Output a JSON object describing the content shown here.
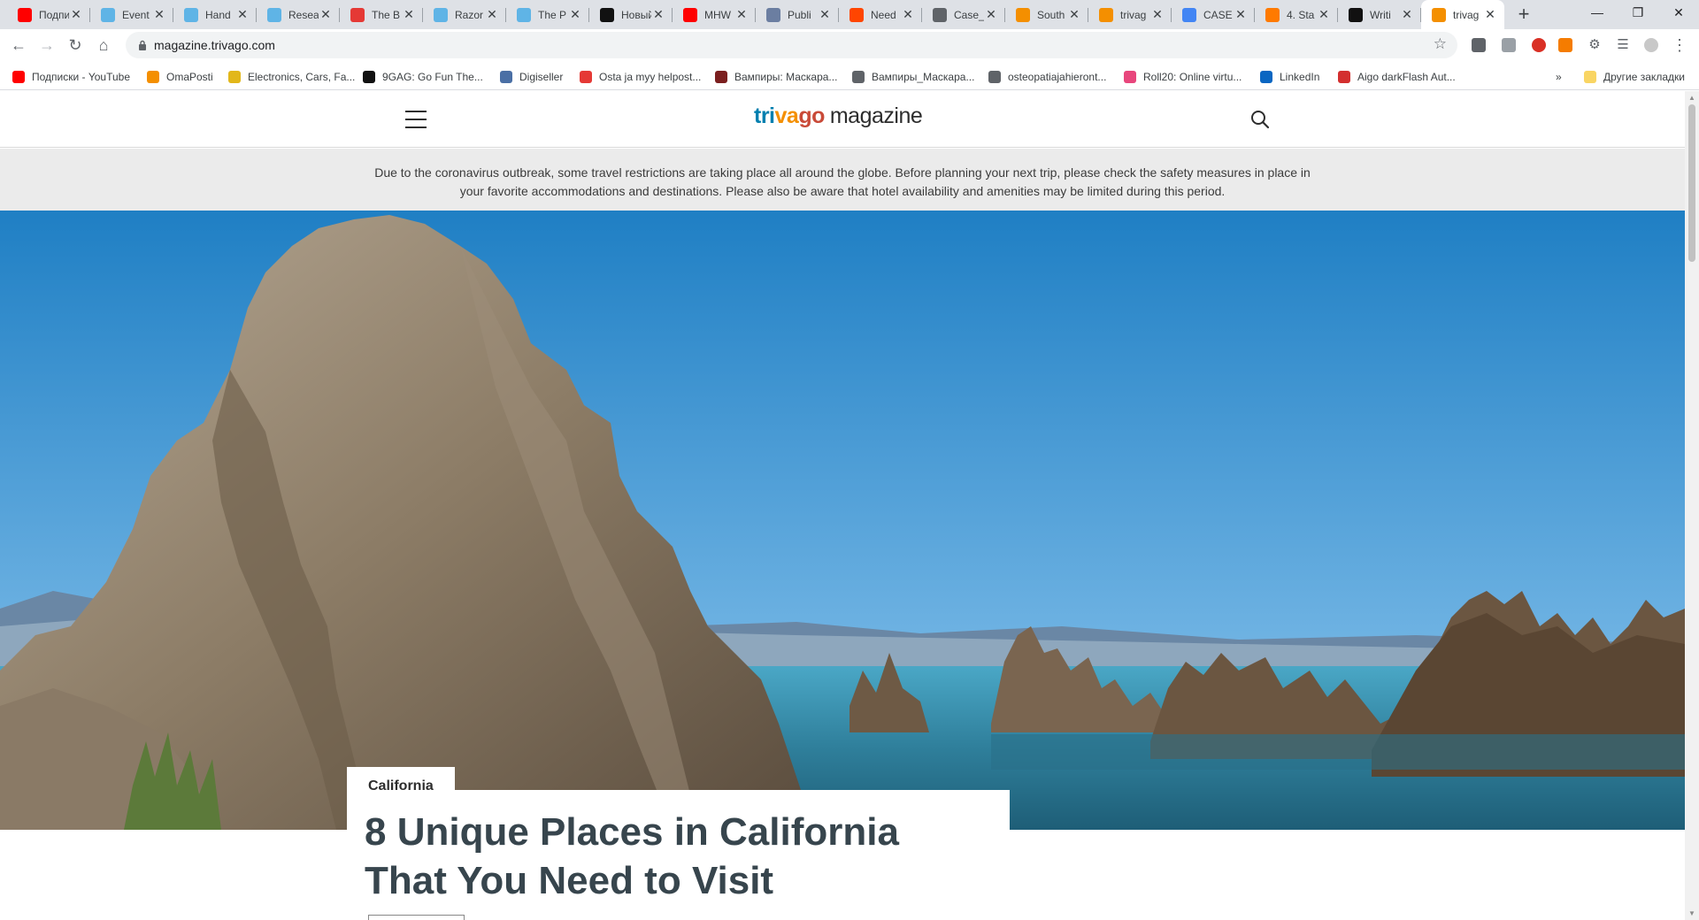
{
  "browser": {
    "tabs": [
      {
        "title": "Подписки",
        "favicon": "youtube-icon",
        "color": "#ff0000"
      },
      {
        "title": "Event",
        "favicon": "product-hunt-icon",
        "color": "#5fb4e6"
      },
      {
        "title": "Hand",
        "favicon": "product-hunt-icon",
        "color": "#5fb4e6"
      },
      {
        "title": "Resea",
        "favicon": "product-hunt-icon",
        "color": "#5fb4e6"
      },
      {
        "title": "The B",
        "favicon": "red-grid-icon",
        "color": "#e53935"
      },
      {
        "title": "Razor",
        "favicon": "product-hunt-icon",
        "color": "#5fb4e6"
      },
      {
        "title": "The P",
        "favicon": "product-hunt-icon",
        "color": "#5fb4e6"
      },
      {
        "title": "Новый",
        "favicon": "k-icon",
        "color": "#111111"
      },
      {
        "title": "MHW",
        "favicon": "youtube-icon",
        "color": "#ff0000"
      },
      {
        "title": "Publi",
        "favicon": "elephant-icon",
        "color": "#6b7ea1"
      },
      {
        "title": "Need",
        "favicon": "reddit-icon",
        "color": "#ff4500"
      },
      {
        "title": "Case_",
        "favicon": "globe-icon",
        "color": "#5f6368"
      },
      {
        "title": "South",
        "favicon": "trivago-icon",
        "color": "#f48f00"
      },
      {
        "title": "trivag",
        "favicon": "trivago-icon",
        "color": "#f48f00"
      },
      {
        "title": "CASE",
        "favicon": "docs-icon",
        "color": "#4285f4"
      },
      {
        "title": "4. Sta",
        "favicon": "butterfly-icon",
        "color": "#ff7a00"
      },
      {
        "title": "Writi",
        "favicon": "medium-icon",
        "color": "#111111"
      },
      {
        "title": "trivag",
        "favicon": "trivago-icon",
        "color": "#f48f00",
        "active": true
      }
    ],
    "new_tab_label": "+",
    "url": "magazine.trivago.com",
    "bookmarks": [
      {
        "label": "Подписки - YouTube",
        "icon": "youtube-icon",
        "color": "#ff0000"
      },
      {
        "label": "OmaPosti",
        "icon": "posti-icon",
        "color": "#f48f00"
      },
      {
        "label": "Electronics, Cars, Fa...",
        "icon": "ebay-icon",
        "color": "#e2b71a"
      },
      {
        "label": "9GAG: Go Fun The...",
        "icon": "9gag-icon",
        "color": "#111111"
      },
      {
        "label": "Digiseller",
        "icon": "bag-icon",
        "color": "#4a6fa5"
      },
      {
        "label": "Osta ja myy helpost...",
        "icon": "tori-icon",
        "color": "#e53935"
      },
      {
        "label": "Вампиры: Маскара...",
        "icon": "vampire-icon",
        "color": "#7b1f1f"
      },
      {
        "label": "Вампиры_Маскара...",
        "icon": "globe-icon",
        "color": "#5f6368"
      },
      {
        "label": "osteopatiajahieront...",
        "icon": "globe-icon",
        "color": "#5f6368"
      },
      {
        "label": "Roll20: Online virtu...",
        "icon": "roll20-icon",
        "color": "#e8467c"
      },
      {
        "label": "LinkedIn",
        "icon": "linkedin-icon",
        "color": "#0a66c2"
      },
      {
        "label": "Aigo darkFlash Aut...",
        "icon": "aigo-icon",
        "color": "#d32f2f"
      }
    ],
    "more_bookmarks_label": "»",
    "other_bookmarks_label": "Другие закладки"
  },
  "site": {
    "logo": {
      "t1": "tri",
      "t2": "va",
      "t3": "go",
      "suffix": "magazine"
    },
    "notice": "Due to the coronavirus outbreak, some travel restrictions are taking place all around the globe. Before planning your next trip, please check the safety measures in place in your favorite accommodations and destinations. Please also be aware that hotel availability and amenities may be limited during this period.",
    "article": {
      "category": "California",
      "title": "8 Unique Places in California That You Need to Visit"
    }
  }
}
